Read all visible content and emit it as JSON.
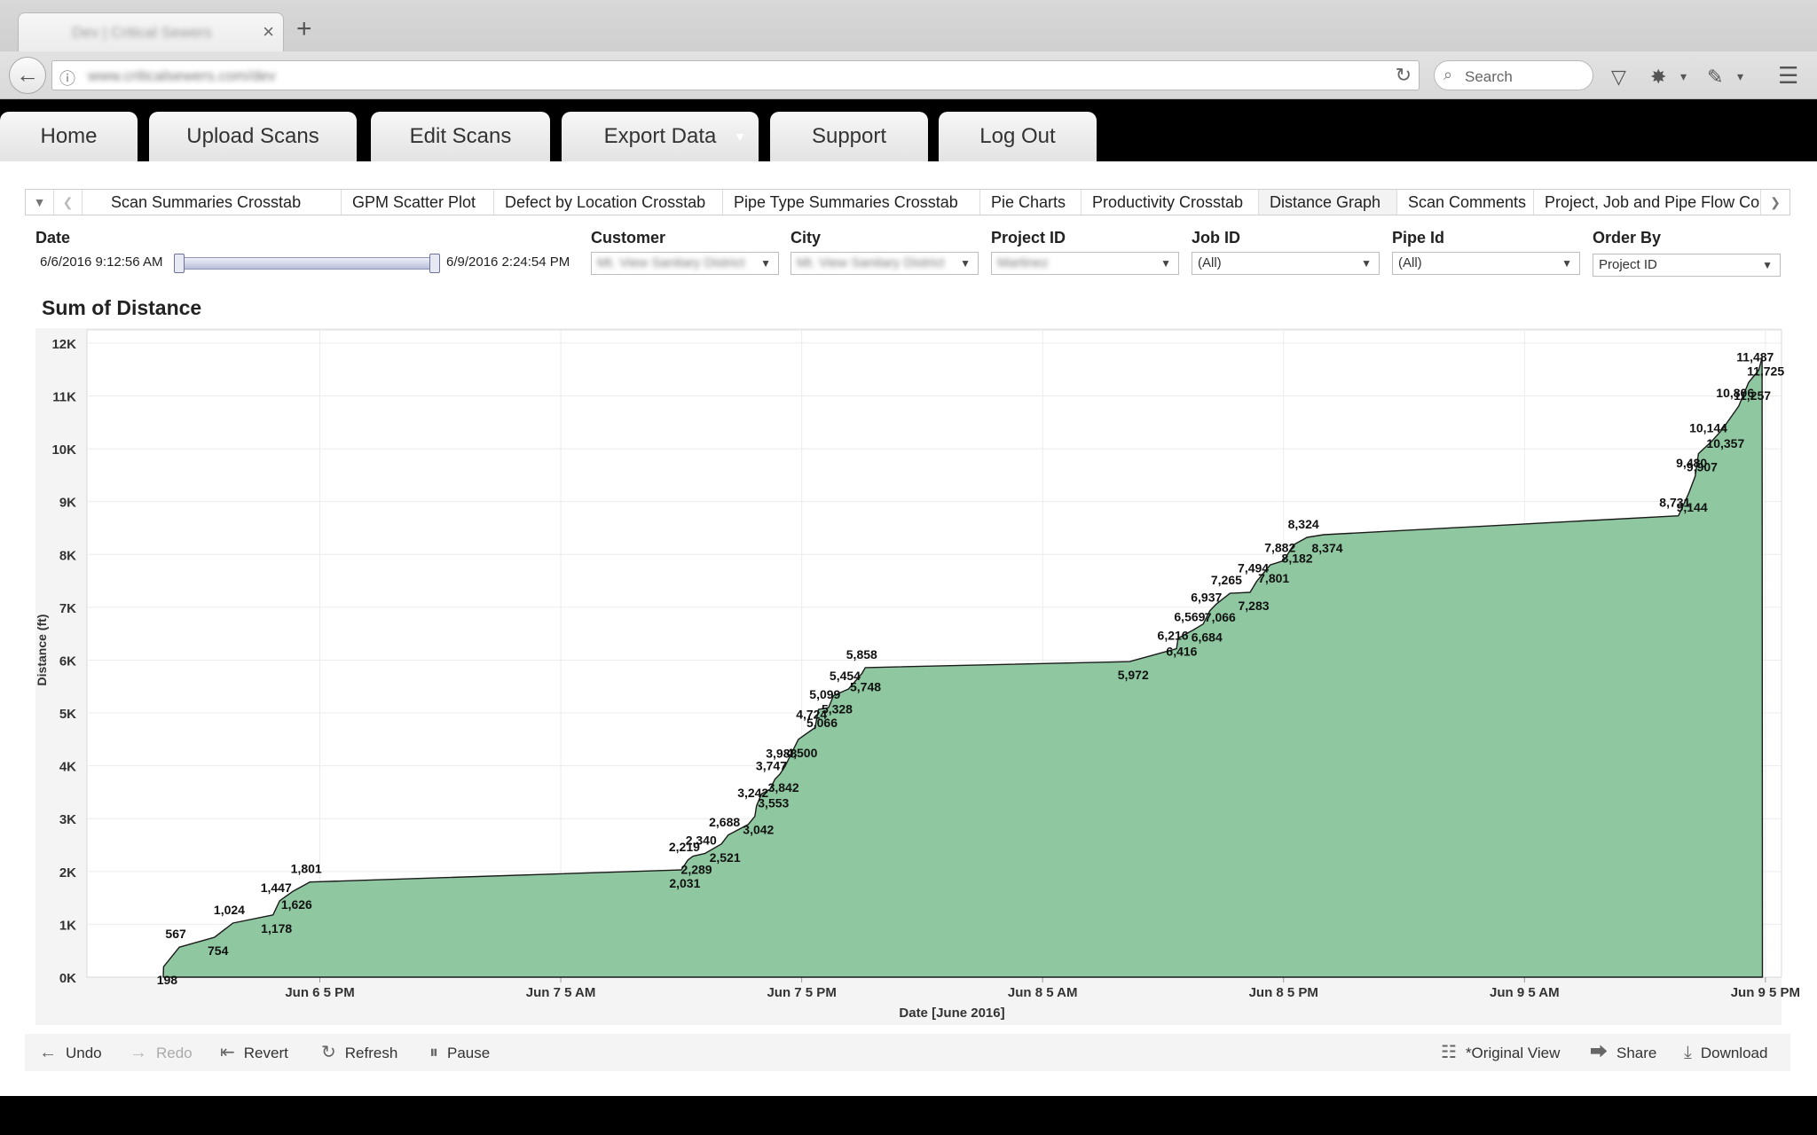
{
  "browser": {
    "tab_title": "Dev | Critical Sewers",
    "tab_close": "×",
    "new_tab": "+",
    "url": "www.criticalsewers.com/dev",
    "search_placeholder": "Search"
  },
  "nav": {
    "items": [
      {
        "label": "Home"
      },
      {
        "label": "Upload Scans"
      },
      {
        "label": "Edit Scans"
      },
      {
        "label": "Export Data"
      },
      {
        "label": "Support"
      },
      {
        "label": "Log Out"
      }
    ]
  },
  "dashboard_tabs": {
    "items": [
      {
        "label": "Scan Summaries Crosstab"
      },
      {
        "label": "GPM Scatter Plot"
      },
      {
        "label": "Defect by Location Crosstab"
      },
      {
        "label": "Pipe Type Summaries Crosstab"
      },
      {
        "label": "Pie Charts"
      },
      {
        "label": "Productivity Crosstab"
      },
      {
        "label": "Distance Graph"
      },
      {
        "label": "Scan Comments"
      },
      {
        "label": "Project, Job and Pipe Flow Cor"
      }
    ],
    "active": "Distance Graph"
  },
  "filters": {
    "date": {
      "label": "Date",
      "start": "6/6/2016 9:12:56 AM",
      "end": "6/9/2016 2:24:54 PM"
    },
    "customer": {
      "label": "Customer",
      "value": "Mt. View Sanitary District"
    },
    "city": {
      "label": "City",
      "value": "Mt. View Sanitary District"
    },
    "project_id": {
      "label": "Project ID",
      "value": "Martinez"
    },
    "job_id": {
      "label": "Job ID",
      "value": "(All)"
    },
    "pipe_id": {
      "label": "Pipe Id",
      "value": "(All)"
    },
    "order_by": {
      "label": "Order By",
      "value": "Project ID"
    }
  },
  "colors": {
    "area_fill": "#8fc8a0",
    "area_line": "#1a1a1a",
    "nav_bg": "#000000"
  },
  "chart_data": {
    "type": "area",
    "title": "Sum of Distance",
    "xlabel": "Date  [June 2016]",
    "ylabel": "Distance (ft)",
    "ylim": [
      0,
      12250
    ],
    "y_ticks": [
      "0K",
      "1K",
      "2K",
      "3K",
      "4K",
      "5K",
      "6K",
      "7K",
      "8K",
      "9K",
      "10K",
      "11K",
      "12K"
    ],
    "x_ticks": [
      "Jun 6 5 PM",
      "Jun 7 5 AM",
      "Jun 7 5 PM",
      "Jun 8 5 AM",
      "Jun 8 5 PM",
      "Jun 9 5 AM",
      "Jun 9 5 PM"
    ],
    "grid": true,
    "points": [
      {
        "x": "2016-06-06 09:12",
        "y": 0
      },
      {
        "x": "2016-06-06 09:13",
        "y": 198
      },
      {
        "x": "2016-06-06 10:00",
        "y": 567
      },
      {
        "x": "2016-06-06 11:45",
        "y": 754
      },
      {
        "x": "2016-06-06 12:40",
        "y": 1024
      },
      {
        "x": "2016-06-06 14:40",
        "y": 1178
      },
      {
        "x": "2016-06-06 15:00",
        "y": 1447
      },
      {
        "x": "2016-06-06 15:40",
        "y": 1626
      },
      {
        "x": "2016-06-06 16:30",
        "y": 1801
      },
      {
        "x": "2016-06-07 11:00",
        "y": 2031
      },
      {
        "x": "2016-06-07 11:20",
        "y": 2219
      },
      {
        "x": "2016-06-07 11:35",
        "y": 2289
      },
      {
        "x": "2016-06-07 12:10",
        "y": 2340
      },
      {
        "x": "2016-06-07 13:00",
        "y": 2521
      },
      {
        "x": "2016-06-07 13:20",
        "y": 2688
      },
      {
        "x": "2016-06-07 14:20",
        "y": 2890
      },
      {
        "x": "2016-06-07 14:40",
        "y": 3042
      },
      {
        "x": "2016-06-07 14:45",
        "y": 3242
      },
      {
        "x": "2016-06-07 15:00",
        "y": 3470
      },
      {
        "x": "2016-06-07 15:25",
        "y": 3553
      },
      {
        "x": "2016-06-07 15:40",
        "y": 3747
      },
      {
        "x": "2016-06-07 15:55",
        "y": 3842
      },
      {
        "x": "2016-06-07 16:10",
        "y": 3988
      },
      {
        "x": "2016-06-07 16:50",
        "y": 4500
      },
      {
        "x": "2016-06-07 17:40",
        "y": 4724
      },
      {
        "x": "2016-06-07 17:50",
        "y": 5066
      },
      {
        "x": "2016-06-07 18:20",
        "y": 5099
      },
      {
        "x": "2016-06-07 18:35",
        "y": 5328
      },
      {
        "x": "2016-06-07 19:20",
        "y": 5454
      },
      {
        "x": "2016-06-07 20:00",
        "y": 5748
      },
      {
        "x": "2016-06-07 20:10",
        "y": 5858
      },
      {
        "x": "2016-06-08 09:20",
        "y": 5972
      },
      {
        "x": "2016-06-08 11:40",
        "y": 6216
      },
      {
        "x": "2016-06-08 11:45",
        "y": 6416
      },
      {
        "x": "2016-06-08 12:30",
        "y": 6569
      },
      {
        "x": "2016-06-08 13:00",
        "y": 6684
      },
      {
        "x": "2016-06-08 13:20",
        "y": 6937
      },
      {
        "x": "2016-06-08 13:40",
        "y": 7066
      },
      {
        "x": "2016-06-08 14:20",
        "y": 7265
      },
      {
        "x": "2016-06-08 15:20",
        "y": 7283
      },
      {
        "x": "2016-06-08 15:40",
        "y": 7494
      },
      {
        "x": "2016-06-08 16:20",
        "y": 7801
      },
      {
        "x": "2016-06-08 17:00",
        "y": 7882
      },
      {
        "x": "2016-06-08 17:30",
        "y": 8182
      },
      {
        "x": "2016-06-08 18:10",
        "y": 8324
      },
      {
        "x": "2016-06-08 19:00",
        "y": 8374
      },
      {
        "x": "2016-06-09 12:40",
        "y": 8731
      },
      {
        "x": "2016-06-09 13:10",
        "y": 9144
      },
      {
        "x": "2016-06-09 13:30",
        "y": 9480
      },
      {
        "x": "2016-06-09 13:40",
        "y": 9907
      },
      {
        "x": "2016-06-09 14:20",
        "y": 10144
      },
      {
        "x": "2016-06-09 14:50",
        "y": 10357
      },
      {
        "x": "2016-06-09 15:40",
        "y": 10806
      },
      {
        "x": "2016-06-09 16:10",
        "y": 11257
      },
      {
        "x": "2016-06-09 16:40",
        "y": 11487
      },
      {
        "x": "2016-06-09 16:50",
        "y": 11725
      },
      {
        "x": "2016-06-09 16:51",
        "y": 0
      }
    ],
    "labels": [
      {
        "text": "198",
        "x": "2016-06-06 09:13",
        "y": 198
      },
      {
        "text": "567",
        "x": "2016-06-06 10:00",
        "y": 567
      },
      {
        "text": "754",
        "x": "2016-06-06 11:45",
        "y": 754
      },
      {
        "text": "1,024",
        "x": "2016-06-06 12:40",
        "y": 1024
      },
      {
        "text": "1,178",
        "x": "2016-06-06 14:40",
        "y": 1178
      },
      {
        "text": "1,447",
        "x": "2016-06-06 15:00",
        "y": 1447
      },
      {
        "text": "1,626",
        "x": "2016-06-06 15:40",
        "y": 1626
      },
      {
        "text": "1,801",
        "x": "2016-06-06 16:30",
        "y": 1801
      },
      {
        "text": "2,031",
        "x": "2016-06-07 11:00",
        "y": 2031
      },
      {
        "text": "2,219",
        "x": "2016-06-07 11:20",
        "y": 2219
      },
      {
        "text": "2,289",
        "x": "2016-06-07 11:35",
        "y": 2289
      },
      {
        "text": "2,340",
        "x": "2016-06-07 12:10",
        "y": 2340
      },
      {
        "text": "2,521",
        "x": "2016-06-07 13:00",
        "y": 2521
      },
      {
        "text": "2,688",
        "x": "2016-06-07 13:20",
        "y": 2688
      },
      {
        "text": "3,042",
        "x": "2016-06-07 14:40",
        "y": 3042
      },
      {
        "text": "3,242",
        "x": "2016-06-07 14:45",
        "y": 3242
      },
      {
        "text": "3,553",
        "x": "2016-06-07 15:25",
        "y": 3553
      },
      {
        "text": "3,747",
        "x": "2016-06-07 15:40",
        "y": 3747
      },
      {
        "text": "3,842",
        "x": "2016-06-07 15:55",
        "y": 3842
      },
      {
        "text": "3,988",
        "x": "2016-06-07 16:10",
        "y": 3988
      },
      {
        "text": "4,500",
        "x": "2016-06-07 16:50",
        "y": 4500
      },
      {
        "text": "4,724",
        "x": "2016-06-07 17:40",
        "y": 4724
      },
      {
        "text": "5,066",
        "x": "2016-06-07 17:50",
        "y": 5066
      },
      {
        "text": "5,099",
        "x": "2016-06-07 18:20",
        "y": 5099
      },
      {
        "text": "5,328",
        "x": "2016-06-07 18:35",
        "y": 5328
      },
      {
        "text": "5,454",
        "x": "2016-06-07 19:20",
        "y": 5454
      },
      {
        "text": "5,748",
        "x": "2016-06-07 20:00",
        "y": 5748
      },
      {
        "text": "5,858",
        "x": "2016-06-07 20:10",
        "y": 5858
      },
      {
        "text": "5,972",
        "x": "2016-06-08 09:20",
        "y": 5972
      },
      {
        "text": "6,216",
        "x": "2016-06-08 11:40",
        "y": 6216
      },
      {
        "text": "6,416",
        "x": "2016-06-08 11:45",
        "y": 6416
      },
      {
        "text": "6,569",
        "x": "2016-06-08 12:30",
        "y": 6569
      },
      {
        "text": "6,684",
        "x": "2016-06-08 13:00",
        "y": 6684
      },
      {
        "text": "6,937",
        "x": "2016-06-08 13:20",
        "y": 6937
      },
      {
        "text": "7,066",
        "x": "2016-06-08 13:40",
        "y": 7066
      },
      {
        "text": "7,265",
        "x": "2016-06-08 14:20",
        "y": 7265
      },
      {
        "text": "7,283",
        "x": "2016-06-08 15:20",
        "y": 7283
      },
      {
        "text": "7,494",
        "x": "2016-06-08 15:40",
        "y": 7494
      },
      {
        "text": "7,801",
        "x": "2016-06-08 16:20",
        "y": 7801
      },
      {
        "text": "7,882",
        "x": "2016-06-08 17:00",
        "y": 7882
      },
      {
        "text": "8,182",
        "x": "2016-06-08 17:30",
        "y": 8182
      },
      {
        "text": "8,324",
        "x": "2016-06-08 18:10",
        "y": 8324
      },
      {
        "text": "8,374",
        "x": "2016-06-08 19:00",
        "y": 8374
      },
      {
        "text": "8,731",
        "x": "2016-06-09 12:40",
        "y": 8731
      },
      {
        "text": "9,144",
        "x": "2016-06-09 13:10",
        "y": 9144
      },
      {
        "text": "9,480",
        "x": "2016-06-09 13:30",
        "y": 9480
      },
      {
        "text": "9,907",
        "x": "2016-06-09 13:40",
        "y": 9907
      },
      {
        "text": "10,144",
        "x": "2016-06-09 14:20",
        "y": 10144
      },
      {
        "text": "10,357",
        "x": "2016-06-09 14:50",
        "y": 10357
      },
      {
        "text": "10,806",
        "x": "2016-06-09 15:40",
        "y": 10806
      },
      {
        "text": "11,257",
        "x": "2016-06-09 16:10",
        "y": 11257
      },
      {
        "text": "11,487",
        "x": "2016-06-09 16:40",
        "y": 11487
      },
      {
        "text": "11,725",
        "x": "2016-06-09 16:50",
        "y": 11725
      }
    ]
  },
  "toolbar": {
    "undo": "Undo",
    "redo": "Redo",
    "revert": "Revert",
    "refresh": "Refresh",
    "pause": "Pause",
    "original_view": "*Original View",
    "share": "Share",
    "download": "Download"
  }
}
